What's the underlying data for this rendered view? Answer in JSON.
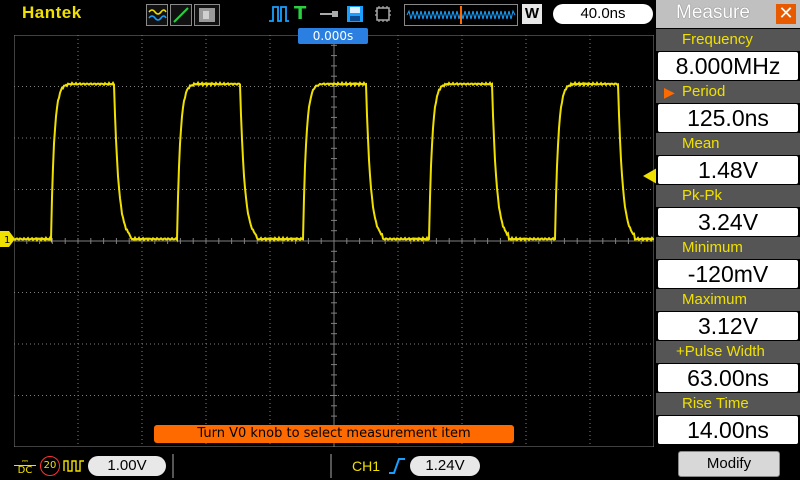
{
  "topbar": {
    "brand": "Hantek",
    "trigger_letter": "T",
    "w_badge": "W",
    "timebase": "40.0ns"
  },
  "screen": {
    "trigger_position": "0.000s",
    "channel_marker": "1",
    "hint": "Turn V0 knob to select measurement item"
  },
  "bottombar": {
    "coupling": "DC",
    "bw_limit": "20",
    "ch1_scale": "1.00V",
    "trigger_source": "CH1",
    "trigger_level": "1.24V"
  },
  "measure": {
    "title": "Measure",
    "items": [
      {
        "label": "Frequency",
        "value": "8.000MHz"
      },
      {
        "label": "Period",
        "value": "125.0ns"
      },
      {
        "label": "Mean",
        "value": "1.48V"
      },
      {
        "label": "Pk-Pk",
        "value": "3.24V"
      },
      {
        "label": "Minimum",
        "value": "-120mV"
      },
      {
        "label": "Maximum",
        "value": "3.12V"
      },
      {
        "label": "+Pulse Width",
        "value": "63.00ns"
      },
      {
        "label": "Rise Time",
        "value": "14.00ns"
      }
    ],
    "modify_label": "Modify"
  },
  "colors": {
    "trace": "#f0e000",
    "grid": "#808080",
    "accent": "#ff6a00",
    "trigger_badge": "#2a7fe0"
  }
}
